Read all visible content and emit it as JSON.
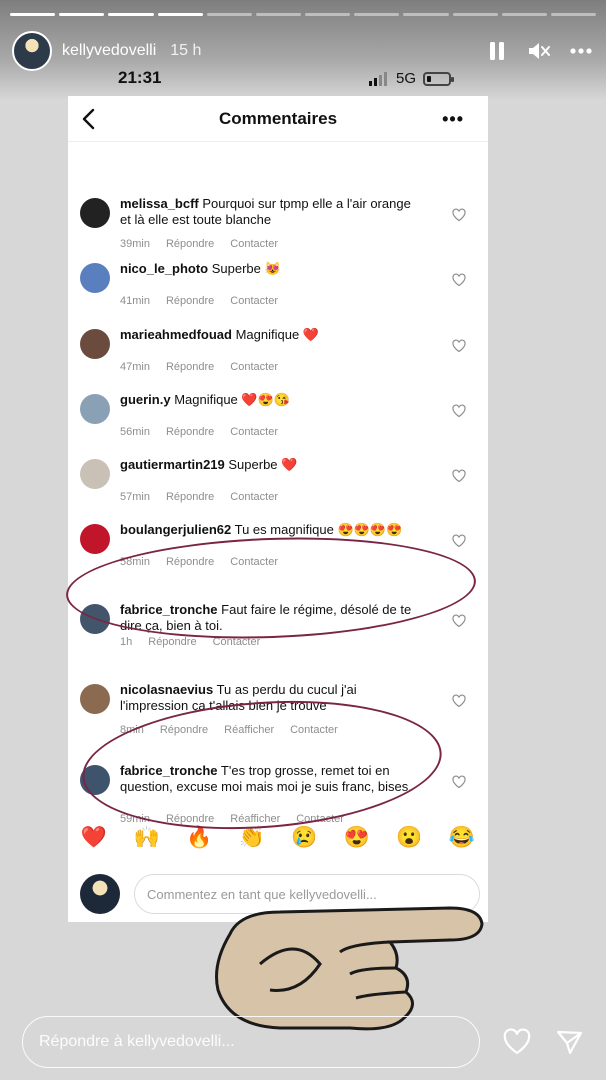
{
  "story": {
    "username": "kellyvedovelli",
    "time_ago": "15 h",
    "progress_segments": 12,
    "progress_completed": 4
  },
  "status_bar": {
    "time": "21:31",
    "network": "5G",
    "signal_bars_on": 2,
    "battery_fraction": 0.2
  },
  "screen": {
    "title": "Commentaires",
    "more_label": "•••",
    "comments": [
      {
        "username": "melissa_bcff",
        "text": "Pourquoi sur tpmp elle a l'air orange et là elle est toute blanche",
        "time": "39min",
        "actions": [
          "Répondre",
          "Contacter"
        ]
      },
      {
        "username": "nico_le_photo",
        "text": "Superbe 😻",
        "time": "41min",
        "actions": [
          "Répondre",
          "Contacter"
        ]
      },
      {
        "username": "marieahmedfouad",
        "text": "Magnifique ❤️",
        "time": "47min",
        "actions": [
          "Répondre",
          "Contacter"
        ]
      },
      {
        "username": "guerin.y",
        "text": "Magnifique ❤️😍😘",
        "time": "56min",
        "actions": [
          "Répondre",
          "Contacter"
        ]
      },
      {
        "username": "gautiermartin219",
        "text": "Superbe ❤️",
        "time": "57min",
        "actions": [
          "Répondre",
          "Contacter"
        ]
      },
      {
        "username": "boulangerjulien62",
        "text": "Tu es magnifique 😍😍😍😍",
        "time": "58min",
        "actions": [
          "Répondre",
          "Contacter"
        ]
      },
      {
        "username": "fabrice_tronche",
        "text": "Faut faire le régime, désolé de te dire ça, bien à toi.",
        "time": "1h",
        "actions": [
          "Répondre",
          "Contacter"
        ]
      },
      {
        "username": "nicolasnaevius",
        "text": "Tu as perdu du cucul j'ai l'impression ça t'allais bien je trouve",
        "time": "8min",
        "actions": [
          "Répondre",
          "Réafficher",
          "Contacter"
        ]
      },
      {
        "username": "fabrice_tronche",
        "text": "T'es trop grosse, remet toi en question, excuse moi mais moi je suis franc, bises.",
        "time": "59min",
        "actions": [
          "Répondre",
          "Réafficher",
          "Contacter"
        ]
      }
    ],
    "quick_reactions": [
      "❤️",
      "🙌",
      "🔥",
      "👏",
      "😢",
      "😍",
      "😮",
      "😂"
    ],
    "comment_placeholder": "Commentez en tant que kellyvedovelli..."
  },
  "reply_placeholder": "Répondre à kellyvedovelli...",
  "colors": {
    "annotation_circle": "#7a2545",
    "avatar_palette": [
      "#222222",
      "#5a7fbf",
      "#6b4b3e",
      "#8aa0b5",
      "#c9c1b6",
      "#c0152a",
      "#43556b",
      "#8a6a50",
      "#3e536c"
    ]
  },
  "icons": {
    "pause": "pause-icon",
    "mute": "mute-icon",
    "options": "more-options-icon",
    "back": "back-arrow-icon",
    "like": "heart-icon",
    "share": "send-icon",
    "sticker": "pointing-hand-sticker"
  }
}
